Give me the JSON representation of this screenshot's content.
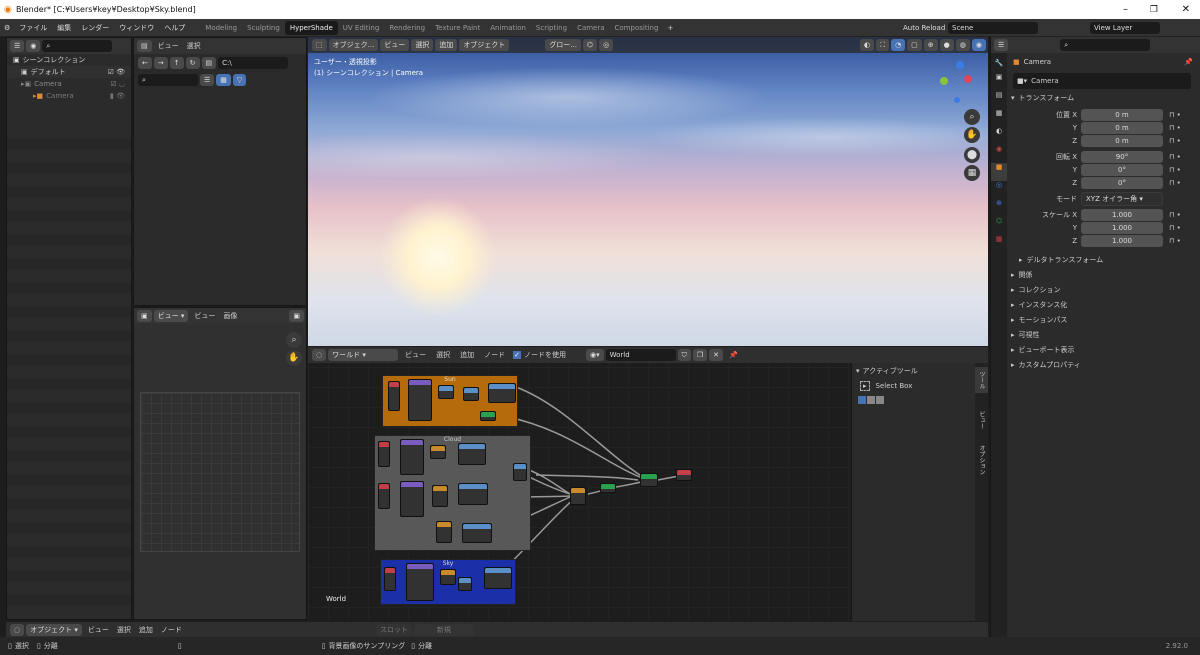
{
  "window": {
    "title": "Blender* [C:¥Users¥key¥Desktop¥Sky.blend]",
    "controls": [
      "–",
      "❐",
      "✕"
    ]
  },
  "menu": {
    "items": [
      "ファイル",
      "編集",
      "レンダー",
      "ウィンドウ",
      "ヘルプ"
    ],
    "workspaces": [
      "Modeling",
      "Sculpting",
      "HyperShade",
      "UV Editing",
      "Rendering",
      "Texture Paint",
      "Animation",
      "Scripting",
      "Camera",
      "Compositing"
    ],
    "auto_reload": "Auto Reload",
    "scene": "Scene",
    "view_layer": "View Layer"
  },
  "outliner": {
    "items": [
      {
        "label": "シーンコレクション"
      },
      {
        "label": "デフォルト"
      },
      {
        "label": "Camera"
      },
      {
        "label": "Camera"
      }
    ]
  },
  "filebrowser": {
    "view": "ビュー",
    "select": "選択",
    "path": "C:\\"
  },
  "image_editor": {
    "view_menu": "ビュー",
    "view": "ビュー",
    "image": "画像"
  },
  "viewport": {
    "header": [
      "オブジェク...",
      "ビュー",
      "選択",
      "追加",
      "オブジェクト"
    ],
    "transform": "グロー...",
    "overlay_line1": "ユーザー・透視投影",
    "overlay_line2": "(1) シーンコレクション | Camera"
  },
  "node_editor": {
    "world_mode": "ワールド",
    "menus": [
      "ビュー",
      "選択",
      "追加",
      "ノード"
    ],
    "use_nodes": "ノードを使用",
    "world_name": "World",
    "corner_label": "World",
    "frames": [
      "Sun",
      "Cloud",
      "Sky"
    ],
    "active_tool_header": "アクティブツール",
    "active_tool": "Select Box",
    "side_tabs": [
      "ツール",
      "ビュー",
      "オプション"
    ]
  },
  "bottom_editor": {
    "mode": "オブジェクト",
    "menus": [
      "ビュー",
      "選択",
      "追加",
      "ノード"
    ],
    "slot": "スロット",
    "new": "新規"
  },
  "statusbar": {
    "select": "選択",
    "split": "分離",
    "sample": "背景画像のサンプリング",
    "split2": "分離",
    "version": "2.92.0"
  },
  "properties": {
    "object_name": "Camera",
    "transform_header": "トランスフォーム",
    "location_label": "位置 X",
    "location": [
      "0 m",
      "0 m",
      "0 m"
    ],
    "rotation_label": "回転 X",
    "rotation": [
      "90°",
      "0°",
      "0°"
    ],
    "mode_label": "モード",
    "mode_value": "XYZ オイラー角",
    "scale_label": "スケール X",
    "scale": [
      "1.000",
      "1.000",
      "1.000"
    ],
    "axis_y": "Y",
    "axis_z": "Z",
    "delta": "デルタトランスフォーム",
    "sections": [
      "関係",
      "コレクション",
      "インスタンス化",
      "モーションパス",
      "可視性",
      "ビューポート表示",
      "カスタムプロパティ"
    ]
  }
}
